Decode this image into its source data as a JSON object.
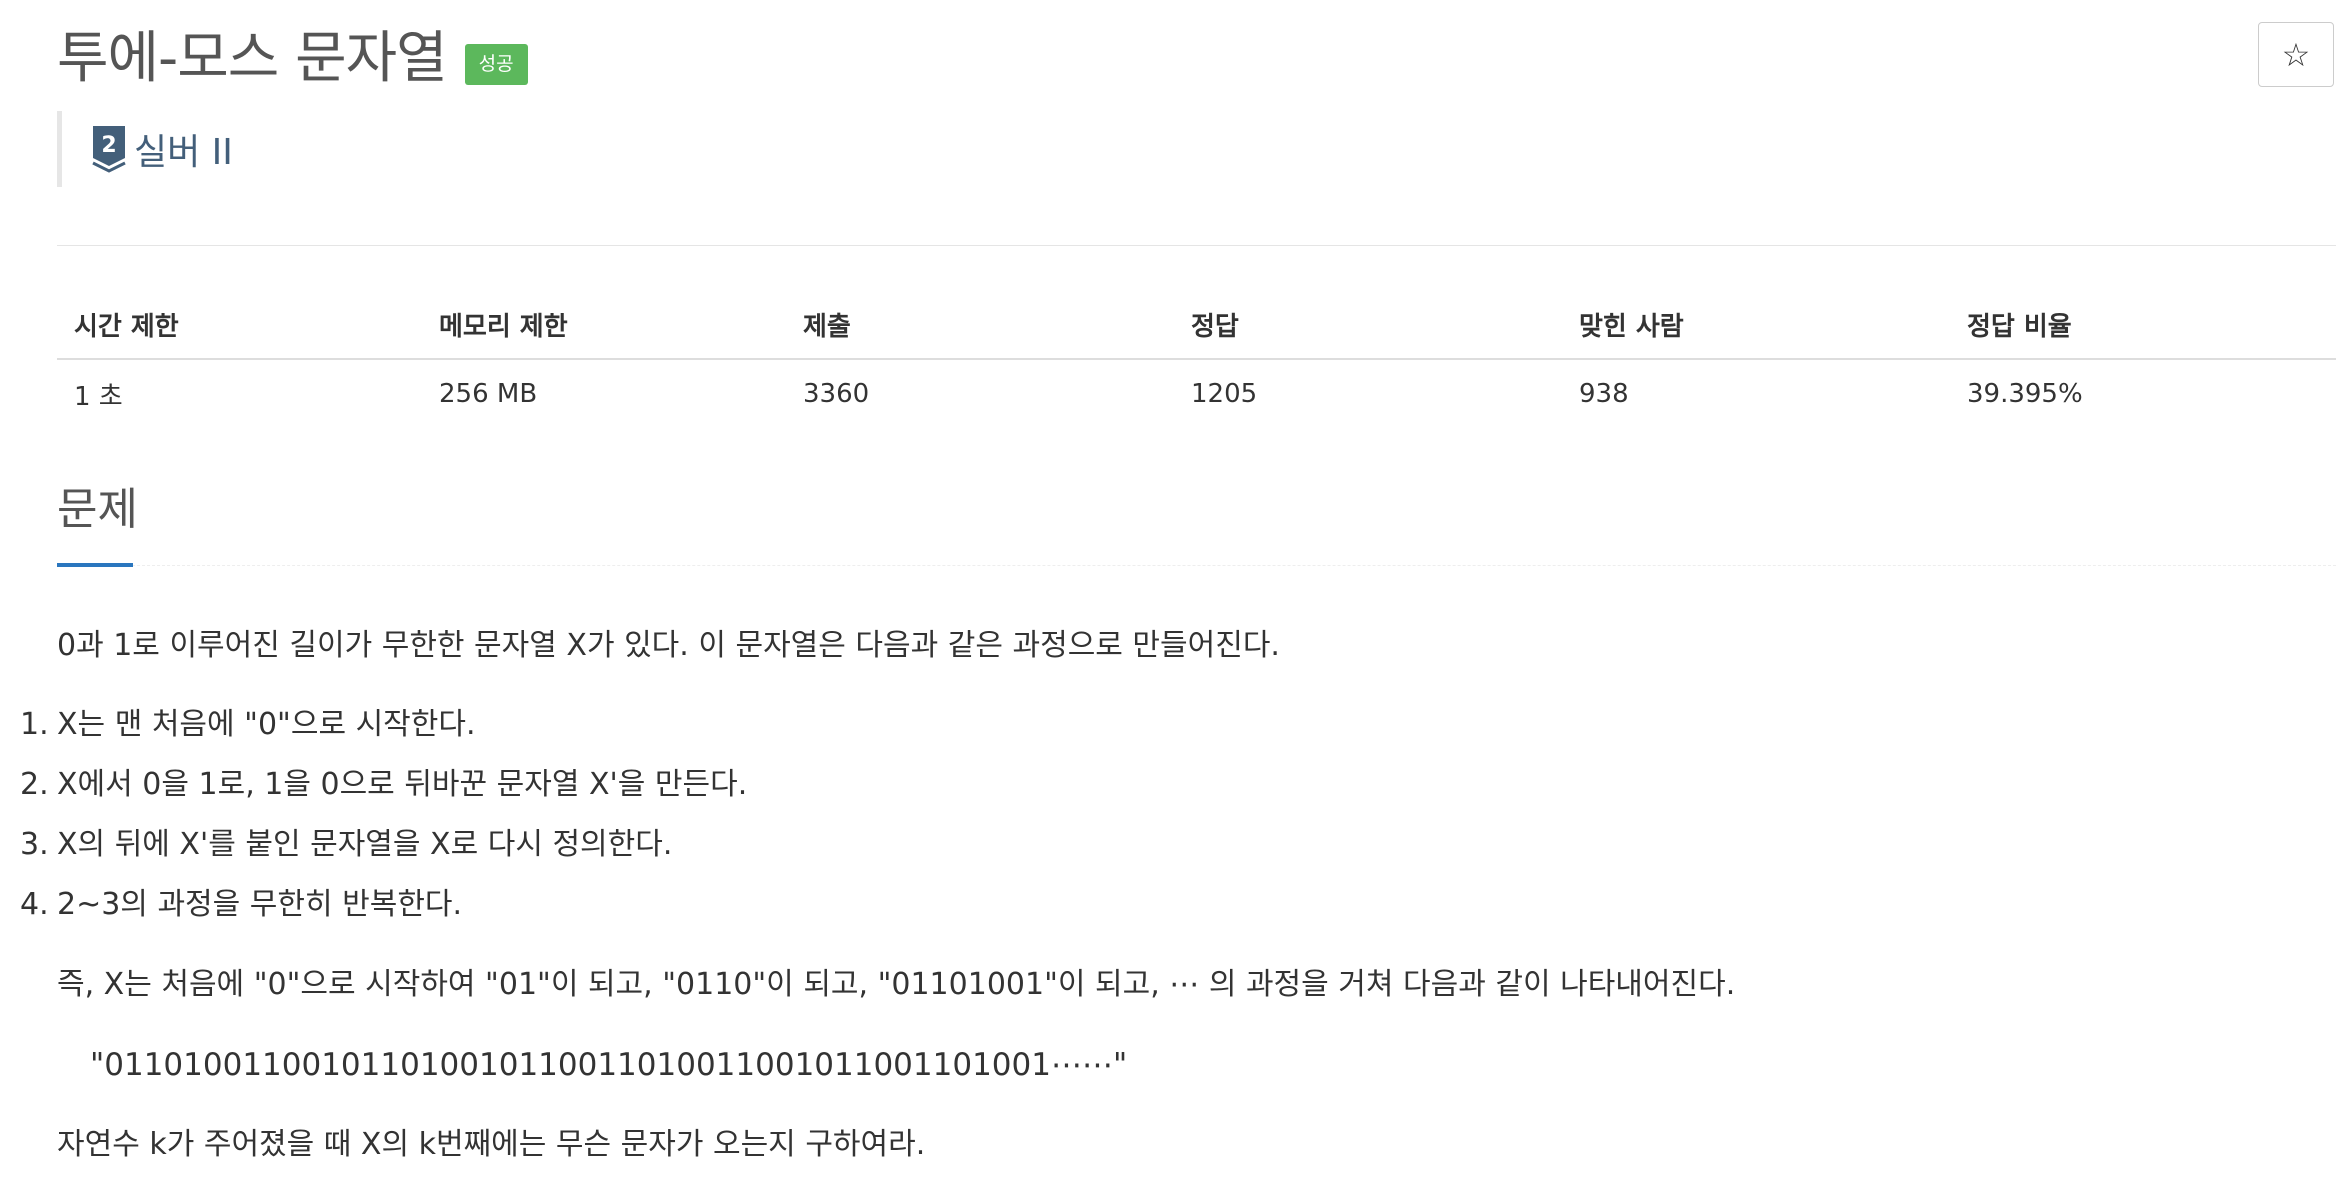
{
  "problem": {
    "title": "투에-모스 문자열",
    "status_badge": "성공",
    "favorite_icon": "☆",
    "tier": {
      "label": "실버 II",
      "number": "2",
      "icon": "silver-tier-shield-icon",
      "color": "#435f7a"
    }
  },
  "info_table": {
    "headers": [
      "시간 제한",
      "메모리 제한",
      "제출",
      "정답",
      "맞힌 사람",
      "정답 비율"
    ],
    "values": [
      "1 초",
      "256 MB",
      "3360",
      "1205",
      "938",
      "39.395%"
    ]
  },
  "section": {
    "title": "문제",
    "intro": "0과 1로 이루어진 길이가 무한한 문자열 X가 있다. 이 문자열은 다음과 같은 과정으로 만들어진다.",
    "steps": [
      {
        "num": "1.",
        "text": "X는 맨 처음에 \"0\"으로 시작한다."
      },
      {
        "num": "2.",
        "text": "X에서 0을 1로, 1을 0으로 뒤바꾼 문자열 X'을 만든다."
      },
      {
        "num": "3.",
        "text": "X의 뒤에 X'를 붙인 문자열을 X로 다시 정의한다."
      },
      {
        "num": "4.",
        "text": "2~3의 과정을 무한히 반복한다."
      }
    ],
    "example_intro": "즉, X는 처음에 \"0\"으로 시작하여 \"01\"이 되고, \"0110\"이 되고, \"01101001\"이 되고, ⋯ 의 과정을 거쳐 다음과 같이 나타내어진다.",
    "sequence": "\"011010011001011010010110011010011001011001101001⋯⋯\"",
    "question": "자연수 k가 주어졌을 때 X의 k번째에는 무슨 문자가 오는지 구하여라."
  },
  "colors": {
    "badge": "#5cb85c",
    "section_underline": "#2a76be",
    "tier": "#435f7a"
  }
}
